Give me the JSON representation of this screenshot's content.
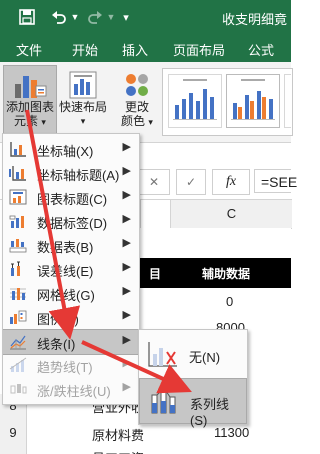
{
  "title_bar": {
    "doc_title": "收支明细竟"
  },
  "ribbon_tabs": [
    "文件",
    "开始",
    "插入",
    "页面布局",
    "公式"
  ],
  "ribbon": {
    "add_chart_element": [
      "添加图表",
      "元素"
    ],
    "quick_layout": "快速布局",
    "change_colors": [
      "更改",
      "颜色"
    ]
  },
  "formula_bar": {
    "fx": "fx",
    "content": "=SEE"
  },
  "grid": {
    "col_c": "C",
    "header_b_partial": "目",
    "header_c": "辅助数据",
    "rows": [
      {
        "row": "",
        "b": "",
        "c": "0"
      },
      {
        "row": "",
        "b": "",
        "c": "8000"
      },
      {
        "row": "8",
        "b": "营业外收入",
        "c": ""
      },
      {
        "row": "9",
        "b": "原材料费",
        "c": "11300"
      },
      {
        "row": "",
        "b": "员工工资",
        "c": ""
      }
    ]
  },
  "menu": {
    "items": [
      {
        "label": "坐标轴(X)",
        "enabled": true
      },
      {
        "label": "坐标轴标题(A)",
        "enabled": true
      },
      {
        "label": "图表标题(C)",
        "enabled": true
      },
      {
        "label": "数据标签(D)",
        "enabled": true
      },
      {
        "label": "数据表(B)",
        "enabled": true
      },
      {
        "label": "误差线(E)",
        "enabled": true
      },
      {
        "label": "网格线(G)",
        "enabled": true
      },
      {
        "label": "图例(L)",
        "enabled": true
      },
      {
        "label": "线条(I)",
        "enabled": true,
        "selected": true
      },
      {
        "label": "趋势线(T)",
        "enabled": false
      },
      {
        "label": "涨/跌柱线(U)",
        "enabled": false
      }
    ]
  },
  "submenu": {
    "items": [
      {
        "label": "无(N)"
      },
      {
        "label": "系列线(S)",
        "selected": true
      }
    ]
  },
  "colors": {
    "excel_green": "#217346",
    "arrow_red": "#e53935",
    "highlight": "#c6c6c6"
  }
}
